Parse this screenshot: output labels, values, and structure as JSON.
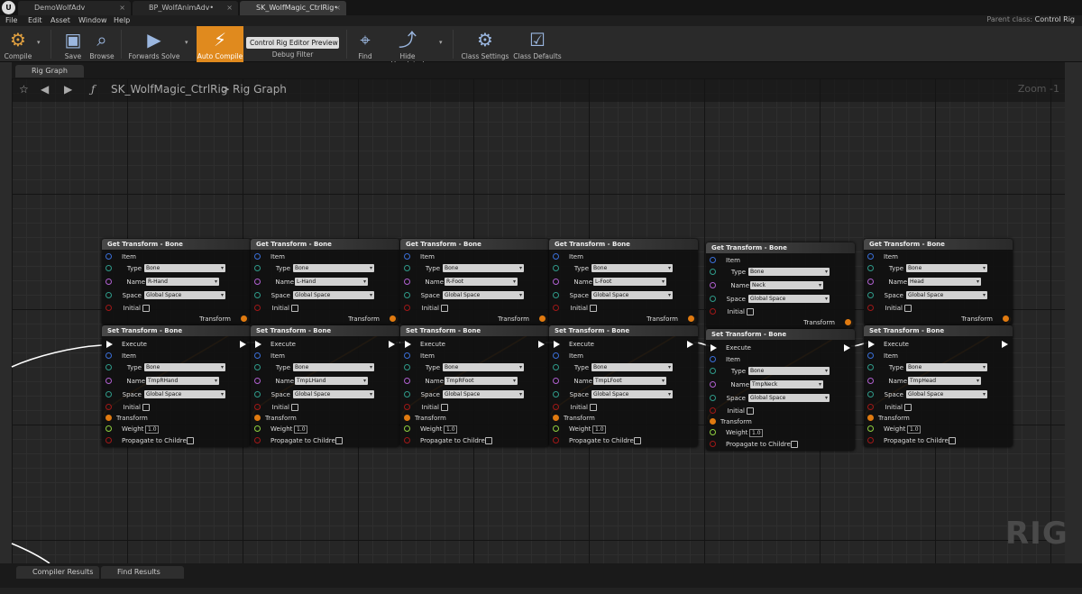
{
  "tabs": [
    {
      "label": "DemoWolfAdv"
    },
    {
      "label": "BP_WolfAnimAdv•"
    },
    {
      "label": "SK_WolfMagic_CtrlRig•"
    }
  ],
  "menu": [
    "File",
    "Edit",
    "Asset",
    "Window",
    "Help"
  ],
  "parent_class": {
    "label": "Parent class:",
    "value": "Control Rig"
  },
  "toolbar": {
    "compile": "Compile",
    "save": "Save",
    "browse": "Browse",
    "forwards_solve": "Forwards Solve",
    "auto_compile": "Auto Compile",
    "debug_value": "Control Rig Editor Preview",
    "debug_filter": "Debug Filter",
    "find": "Find",
    "hide_unrelated": "Hide Unrelated",
    "class_settings": "Class Settings",
    "class_defaults": "Class Defaults"
  },
  "graph_tab": "Rig Graph",
  "breadcrumb": {
    "asset": "SK_WolfMagic_CtrlRig",
    "sep": ">",
    "graph": "Rig Graph"
  },
  "zoom": "Zoom -1",
  "watermark": "RIG",
  "bottom_tabs": {
    "compiler": "Compiler Results",
    "find": "Find Results"
  },
  "node_labels": {
    "get_title": "Get Transform - Bone",
    "set_title": "Set Transform - Bone",
    "item": "Item",
    "type": "Type",
    "name": "Name",
    "space": "Space",
    "initial": "Initial",
    "transform": "Transform",
    "execute": "Execute",
    "weight": "Weight",
    "propagate": "Propagate to Children",
    "bone": "Bone",
    "global_space": "Global Space"
  },
  "columns": [
    {
      "bone": "R-Hand",
      "tmp": "TmpRHand",
      "weight": "1.0"
    },
    {
      "bone": "L-Hand",
      "tmp": "TmpLHand",
      "weight": "1.0"
    },
    {
      "bone": "R-Foot",
      "tmp": "TmpRFoot",
      "weight": "1.0"
    },
    {
      "bone": "L-Foot",
      "tmp": "TmpLFoot",
      "weight": "1.0"
    },
    {
      "bone": "Neck",
      "tmp": "TmpNeck",
      "weight": "1.0"
    },
    {
      "bone": "Head",
      "tmp": "TmpHead",
      "weight": "1.0"
    }
  ],
  "colors": {
    "accent": "#e08a1e",
    "wire": "#e07a10",
    "item_pin": "#3a6fd8",
    "type_pin": "#2f9b8a",
    "name_pin": "#b060d0",
    "space_pin": "#2f9b8a",
    "bool_pin": "#a01818",
    "weight_pin": "#8fd040"
  }
}
